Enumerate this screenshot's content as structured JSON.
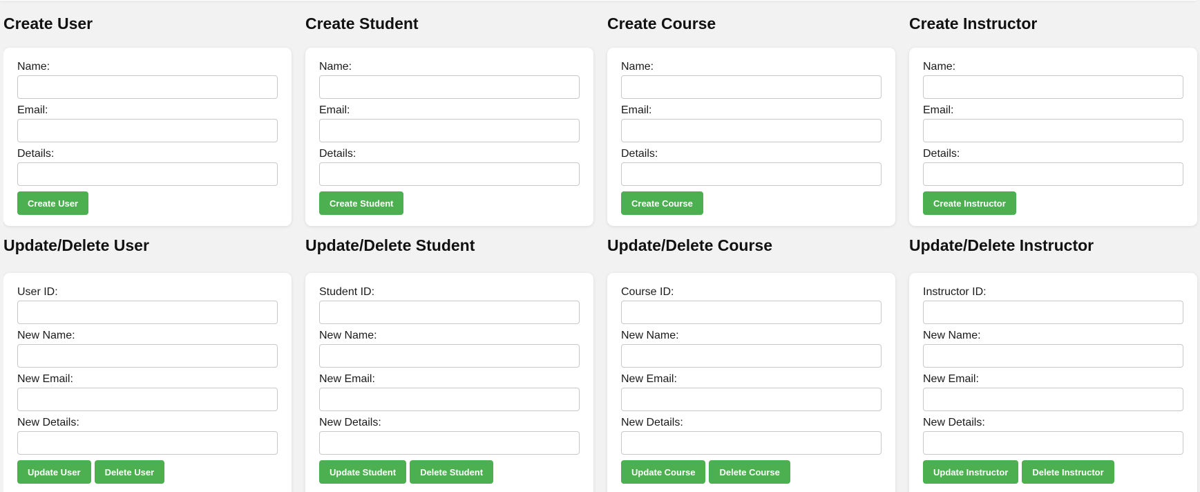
{
  "create_sections": [
    {
      "title": "Create User",
      "fields": [
        "Name:",
        "Email:",
        "Details:"
      ],
      "button": "Create User"
    },
    {
      "title": "Create Student",
      "fields": [
        "Name:",
        "Email:",
        "Details:"
      ],
      "button": "Create Student"
    },
    {
      "title": "Create Course",
      "fields": [
        "Name:",
        "Email:",
        "Details:"
      ],
      "button": "Create Course"
    },
    {
      "title": "Create Instructor",
      "fields": [
        "Name:",
        "Email:",
        "Details:"
      ],
      "button": "Create Instructor"
    }
  ],
  "update_sections": [
    {
      "title": "Update/Delete User",
      "fields": [
        "User ID:",
        "New Name:",
        "New Email:",
        "New Details:"
      ],
      "update_button": "Update User",
      "delete_button": "Delete User"
    },
    {
      "title": "Update/Delete Student",
      "fields": [
        "Student ID:",
        "New Name:",
        "New Email:",
        "New Details:"
      ],
      "update_button": "Update Student",
      "delete_button": "Delete Student"
    },
    {
      "title": "Update/Delete Course",
      "fields": [
        "Course ID:",
        "New Name:",
        "New Email:",
        "New Details:"
      ],
      "update_button": "Update Course",
      "delete_button": "Delete Course"
    },
    {
      "title": "Update/Delete Instructor",
      "fields": [
        "Instructor ID:",
        "New Name:",
        "New Email:",
        "New Details:"
      ],
      "update_button": "Update Instructor",
      "delete_button": "Delete Instructor"
    }
  ],
  "colors": {
    "page_background": "#f2f2f2",
    "card_background": "#ffffff",
    "button_green": "#4caf50",
    "button_text": "#ffffff"
  }
}
